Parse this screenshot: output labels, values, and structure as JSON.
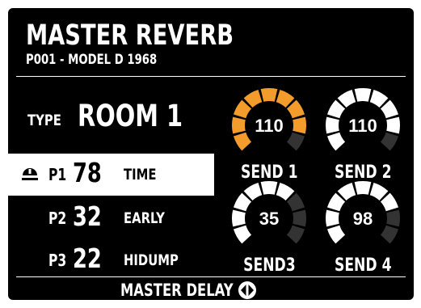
{
  "title": "MASTER REVERB",
  "subtitle": "P001 - MODEL D 1968",
  "type": {
    "label": "TYPE",
    "value": "ROOM 1"
  },
  "params": [
    {
      "label": "P1",
      "value": "78",
      "name": "TIME",
      "selected": true
    },
    {
      "label": "P2",
      "value": "32",
      "name": "EARLY",
      "selected": false
    },
    {
      "label": "P3",
      "value": "22",
      "name": "HIDUMP",
      "selected": false
    }
  ],
  "knobs": [
    {
      "value": "110",
      "label": "SEND 1",
      "level_segments": 8,
      "total_segments": 9,
      "color": "#f39c2b"
    },
    {
      "value": "110",
      "label": "SEND 2",
      "level_segments": 8,
      "total_segments": 9,
      "color": "#ffffff"
    },
    {
      "value": "35",
      "label": "SEND3",
      "level_segments": 6,
      "total_segments": 9,
      "color": "#ffffff"
    },
    {
      "value": "98",
      "label": "SEND 4",
      "level_segments": 7,
      "total_segments": 9,
      "color": "#ffffff"
    }
  ],
  "footer": {
    "label": "MASTER DELAY",
    "icon": "left-right-arrows-icon"
  },
  "colors": {
    "background": "#000000",
    "text": "#ffffff",
    "accent": "#f39c2b",
    "inactive_segment": "#333333"
  },
  "selected_icon": "tuner-selector-icon"
}
